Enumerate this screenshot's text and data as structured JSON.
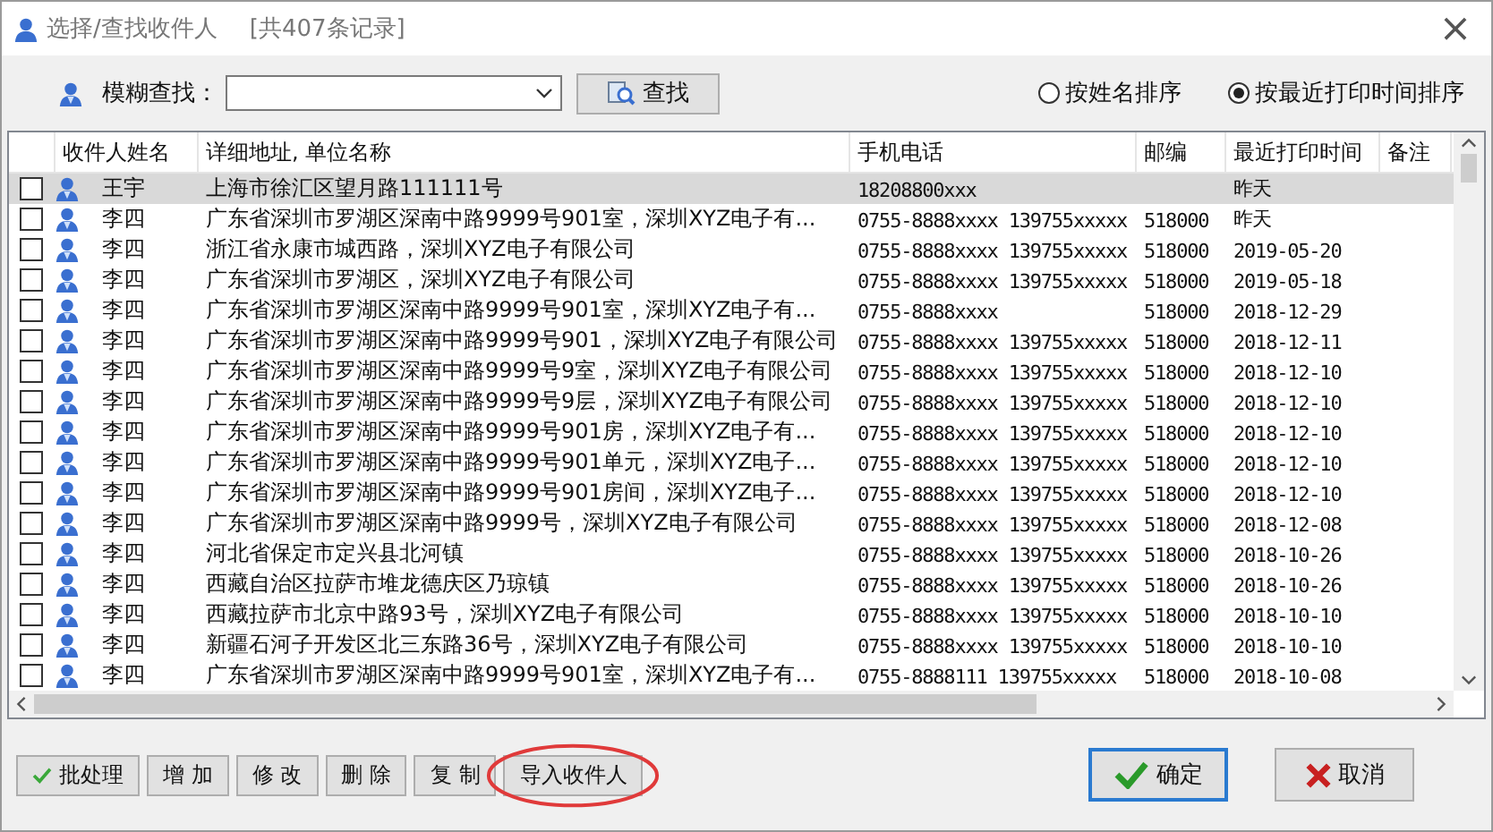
{
  "window": {
    "title": "选择/查找收件人",
    "record_count": "[共407条记录]",
    "close": "×"
  },
  "search": {
    "label": "模糊查找：",
    "button": "查找"
  },
  "sort_options": [
    {
      "label": "按姓名排序",
      "selected": false
    },
    {
      "label": "按最近打印时间排序",
      "selected": true
    }
  ],
  "table": {
    "columns": [
      "收件人姓名",
      "详细地址, 单位名称",
      "手机电话",
      "邮编",
      "最近打印时间",
      "备注"
    ],
    "rows": [
      {
        "checked": false,
        "selected": true,
        "name": "王宇",
        "address": "上海市徐汇区望月路111111号",
        "phone": "18208800xxx",
        "date": "昨天"
      },
      {
        "checked": false,
        "selected": false,
        "name": "李四",
        "address": "广东省深圳市罗湖区深南中路9999号901室，深圳XYZ电子有...",
        "phone": "0755-8888xxxx 139755xxxxx",
        "zip": "518000",
        "date": "昨天"
      },
      {
        "checked": false,
        "selected": false,
        "name": "李四",
        "address": "浙江省永康市城西路，深圳XYZ电子有限公司",
        "phone": "0755-8888xxxx 139755xxxxx",
        "zip": "518000",
        "date": "2019-05-20"
      },
      {
        "checked": false,
        "selected": false,
        "name": "李四",
        "address": "广东省深圳市罗湖区，深圳XYZ电子有限公司",
        "phone": "0755-8888xxxx 139755xxxxx",
        "zip": "518000",
        "date": "2019-05-18"
      },
      {
        "checked": false,
        "selected": false,
        "name": "李四",
        "address": "广东省深圳市罗湖区深南中路9999号901室，深圳XYZ电子有...",
        "phone": "0755-8888xxxx",
        "zip": "518000",
        "date": "2018-12-29"
      },
      {
        "checked": false,
        "selected": false,
        "name": "李四",
        "address": "广东省深圳市罗湖区深南中路9999号901，深圳XYZ电子有限公司",
        "phone": "0755-8888xxxx 139755xxxxx",
        "zip": "518000",
        "date": "2018-12-11"
      },
      {
        "checked": false,
        "selected": false,
        "name": "李四",
        "address": "广东省深圳市罗湖区深南中路9999号9室，深圳XYZ电子有限公司",
        "phone": "0755-8888xxxx 139755xxxxx",
        "zip": "518000",
        "date": "2018-12-10"
      },
      {
        "checked": false,
        "selected": false,
        "name": "李四",
        "address": "广东省深圳市罗湖区深南中路9999号9层，深圳XYZ电子有限公司",
        "phone": "0755-8888xxxx 139755xxxxx",
        "zip": "518000",
        "date": "2018-12-10"
      },
      {
        "checked": false,
        "selected": false,
        "name": "李四",
        "address": "广东省深圳市罗湖区深南中路9999号901房，深圳XYZ电子有...",
        "phone": "0755-8888xxxx 139755xxxxx",
        "zip": "518000",
        "date": "2018-12-10"
      },
      {
        "checked": false,
        "selected": false,
        "name": "李四",
        "address": "广东省深圳市罗湖区深南中路9999号901单元，深圳XYZ电子...",
        "phone": "0755-8888xxxx 139755xxxxx",
        "zip": "518000",
        "date": "2018-12-10"
      },
      {
        "checked": false,
        "selected": false,
        "name": "李四",
        "address": "广东省深圳市罗湖区深南中路9999号901房间，深圳XYZ电子...",
        "phone": "0755-8888xxxx 139755xxxxx",
        "zip": "518000",
        "date": "2018-12-10"
      },
      {
        "checked": false,
        "selected": false,
        "name": "李四",
        "address": "广东省深圳市罗湖区深南中路9999号，深圳XYZ电子有限公司",
        "phone": "0755-8888xxxx 139755xxxxx",
        "zip": "518000",
        "date": "2018-12-08"
      },
      {
        "checked": false,
        "selected": false,
        "name": "李四",
        "address": "河北省保定市定兴县北河镇",
        "phone": "0755-8888xxxx 139755xxxxx",
        "zip": "518000",
        "date": "2018-10-26"
      },
      {
        "checked": false,
        "selected": false,
        "name": "李四",
        "address": "西藏自治区拉萨市堆龙德庆区乃琼镇",
        "phone": "0755-8888xxxx 139755xxxxx",
        "zip": "518000",
        "date": "2018-10-26"
      },
      {
        "checked": false,
        "selected": false,
        "name": "李四",
        "address": "西藏拉萨市北京中路93号，深圳XYZ电子有限公司",
        "phone": "0755-8888xxxx 139755xxxxx",
        "zip": "518000",
        "date": "2018-10-10"
      },
      {
        "checked": false,
        "selected": false,
        "name": "李四",
        "address": "新疆石河子开发区北三东路36号，深圳XYZ电子有限公司",
        "phone": "0755-8888xxxx 139755xxxxx",
        "zip": "518000",
        "date": "2018-10-10"
      },
      {
        "checked": false,
        "selected": false,
        "name": "李四",
        "address": "广东省深圳市罗湖区深南中路9999号901室，深圳XYZ电子有...",
        "phone": "0755-8888111 139755xxxxx",
        "zip": "518000",
        "date": "2018-10-08"
      }
    ]
  },
  "actions": [
    {
      "label": "批处理",
      "kind": "check",
      "highlighted": false
    },
    {
      "label": "增 加",
      "kind": "plain",
      "highlighted": false
    },
    {
      "label": "修 改",
      "kind": "plain",
      "highlighted": false
    },
    {
      "label": "删 除",
      "kind": "plain",
      "highlighted": false
    },
    {
      "label": "复 制",
      "kind": "plain",
      "highlighted": false
    },
    {
      "label": "导入收件人",
      "kind": "plain",
      "highlighted": true
    }
  ],
  "dialog_buttons": [
    {
      "label": "确定",
      "kind": "ok"
    },
    {
      "label": "取消",
      "kind": "cancel"
    }
  ]
}
